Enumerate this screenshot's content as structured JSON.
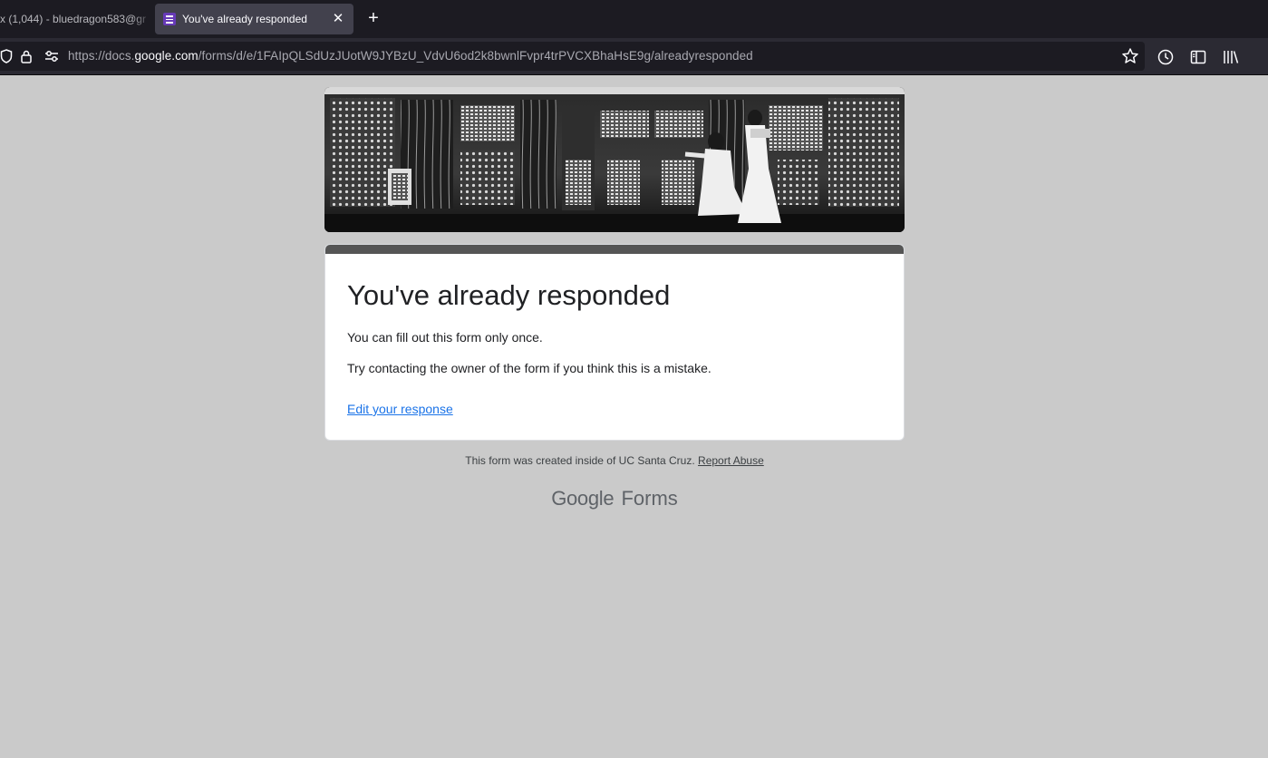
{
  "browser": {
    "tabs": [
      {
        "title": "x (1,044) - bluedragon583@gr",
        "active": false
      },
      {
        "title": "You've already responded",
        "active": true
      }
    ],
    "url_prefix": "https://docs.",
    "url_host": "google.com",
    "url_path": "/forms/d/e/1FAIpQLSdUzJUotW9JYBzU_VdvU6od2k8bwnlFvpr4trPVCXBhaHsE9g/alreadyresponded"
  },
  "form": {
    "title": "You've already responded",
    "line1": "You can fill out this form only once.",
    "line2": "Try contacting the owner of the form if you think this is a mistake.",
    "edit_link": "Edit your response",
    "accent_bar_color": "#555555",
    "link_color": "#1a73e8"
  },
  "footer": {
    "created_text": "This form was created inside of UC Santa Cruz.",
    "report_abuse": "Report Abuse",
    "logo_google": "Google",
    "logo_forms": "Forms"
  },
  "icons": [
    "shield-icon",
    "lock-icon",
    "permissions-icon",
    "bookmark-star-icon",
    "history-icon",
    "sidebar-icon",
    "library-icon",
    "new-tab-icon",
    "close-icon",
    "forms-favicon"
  ]
}
